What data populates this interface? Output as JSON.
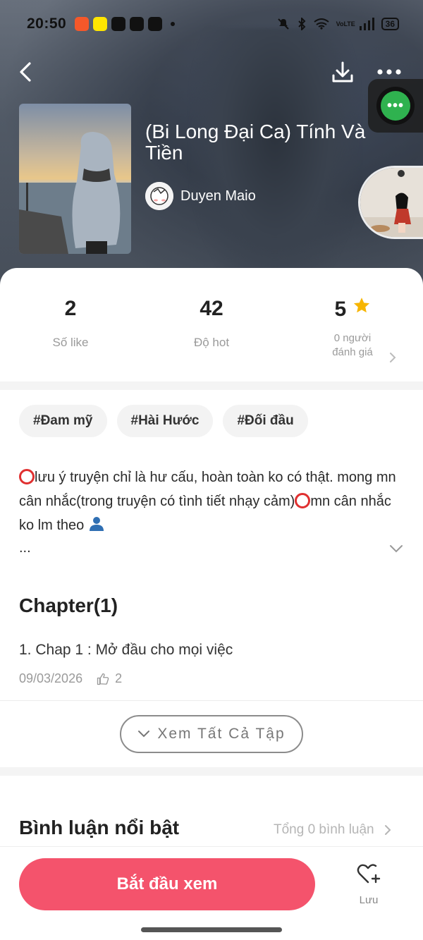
{
  "status_bar": {
    "time": "20:50",
    "network": "VoLTE",
    "battery": "36"
  },
  "header": {
    "back_icon": "chevron-left-icon",
    "download_icon": "download-icon",
    "more_icon": "more-dots-icon",
    "floating_button_text": "•••"
  },
  "story": {
    "title": "(Bi Long Đại Ca) Tính Và Tiền",
    "author": "Duyen Maio"
  },
  "stats": {
    "likes_value": "2",
    "likes_label": "Số like",
    "hot_value": "42",
    "hot_label": "Độ hot",
    "rating_value": "5",
    "rating_label_line1": "0 người",
    "rating_label_line2": "đánh giá"
  },
  "tags": [
    "#Đam mỹ",
    "#Hài Hước",
    "#Đối đầu"
  ],
  "description": {
    "part1": "lưu ý truyện chỉ là hư cấu, hoàn toàn ko có thật. mong mn cân nhắc(trong truyện có tình tiết nhạy cảm)",
    "part2": "mn cân nhắc ko lm theo ",
    "ellipsis": "..."
  },
  "chapters": {
    "header": "Chapter(1)",
    "items": [
      {
        "title": "1. Chap 1 : Mở đầu cho mọi việc",
        "date": "09/03/2026",
        "likes": "2"
      }
    ],
    "see_all_label": "Xem Tất Cả Tập"
  },
  "comments": {
    "header": "Bình luận nổi bật",
    "total": "Tổng 0 bình luận"
  },
  "bottom": {
    "start_label": "Bắt đầu xem",
    "save_label": "Lưu"
  },
  "colors": {
    "accent": "#f4536c",
    "star": "#f7b500",
    "ring": "#e03030"
  }
}
